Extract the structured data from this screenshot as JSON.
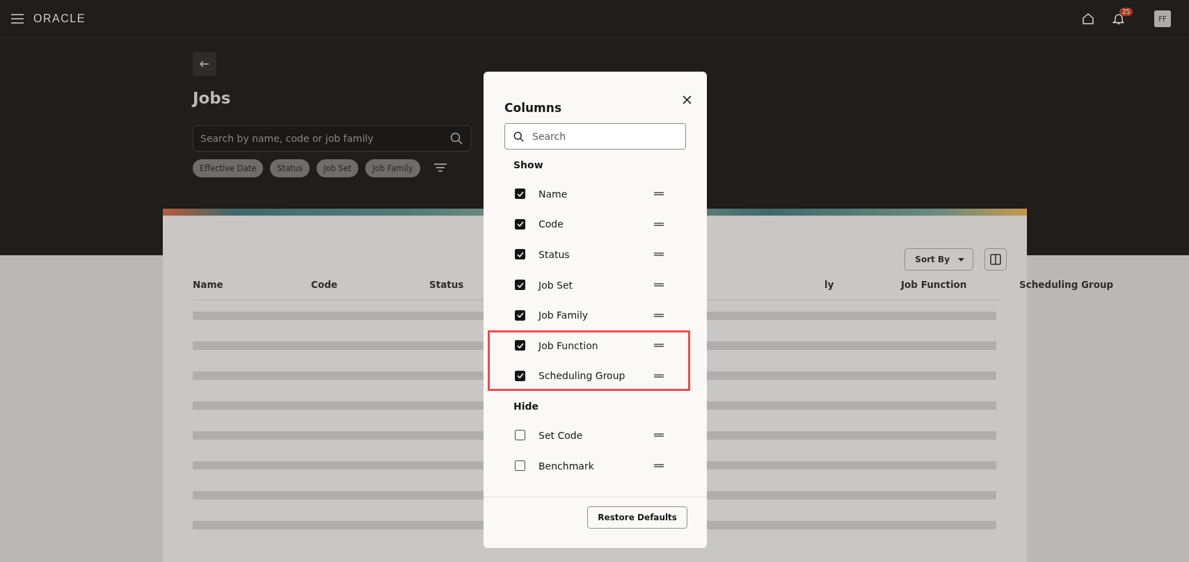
{
  "header": {
    "brand": "ORACLE",
    "notifications_count": "25",
    "avatar_initials": "FF"
  },
  "page": {
    "title": "Jobs",
    "search": {
      "placeholder": "Search by name, code or job family"
    },
    "filters": [
      "Effective Date",
      "Status",
      "Job Set",
      "Job Family"
    ]
  },
  "table": {
    "sort_button": "Sort By",
    "columns": [
      "Name",
      "Code",
      "Status",
      "ly",
      "Job Function",
      "Scheduling Group"
    ]
  },
  "columns_dialog": {
    "title": "Columns",
    "search": {
      "placeholder": "Search"
    },
    "sections": [
      {
        "heading": "Show",
        "items": [
          {
            "label": "Name",
            "checked": true,
            "highlighted": false
          },
          {
            "label": "Code",
            "checked": true,
            "highlighted": false
          },
          {
            "label": "Status",
            "checked": true,
            "highlighted": false
          },
          {
            "label": "Job Set",
            "checked": true,
            "highlighted": false
          },
          {
            "label": "Job Family",
            "checked": true,
            "highlighted": false
          },
          {
            "label": "Job Function",
            "checked": true,
            "highlighted": true
          },
          {
            "label": "Scheduling Group",
            "checked": true,
            "highlighted": true
          }
        ]
      },
      {
        "heading": "Hide",
        "items": [
          {
            "label": "Set Code",
            "checked": false,
            "highlighted": false
          },
          {
            "label": "Benchmark",
            "checked": false,
            "highlighted": false
          }
        ]
      }
    ],
    "restore_button": "Restore Defaults"
  }
}
